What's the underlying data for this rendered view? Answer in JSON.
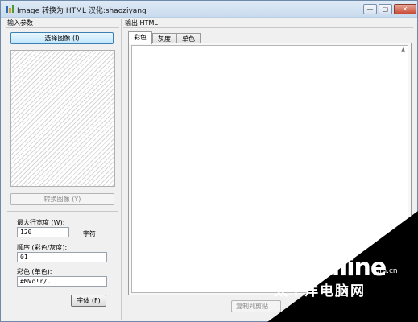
{
  "window": {
    "title": "Image 转换为 HTML   汉化:shaoziyang",
    "min_label": "—",
    "max_label": "▢",
    "close_label": "✕"
  },
  "left_panel": {
    "group_label": "输入参数",
    "select_image_button": "选择图像 (I)",
    "convert_image_button": "转换图像 (Y)",
    "max_width_label": "最大行宽度 (W):",
    "max_width_value": "120",
    "max_width_unit": "字符",
    "order_label": "顺序 (彩色/灰度):",
    "order_value": "01",
    "color_label": "彩色 (单色):",
    "color_value": "#MVo!r/.",
    "font_button": "字体 (F)"
  },
  "right_panel": {
    "group_label": "输出 HTML",
    "tabs": [
      {
        "label": "彩色",
        "active": true
      },
      {
        "label": "灰度",
        "active": false
      },
      {
        "label": "单色",
        "active": false
      }
    ],
    "copy_button": "复制到剪贴"
  },
  "watermark": {
    "brand": "PConline",
    "domain": ".com.cn",
    "chinese": "太平洋电脑网"
  },
  "colors": {
    "window_bg": "#f0f0f0",
    "title_bg": "#c9dbee",
    "accent_button": "#bee6fd",
    "watermark_bg": "#000000"
  }
}
